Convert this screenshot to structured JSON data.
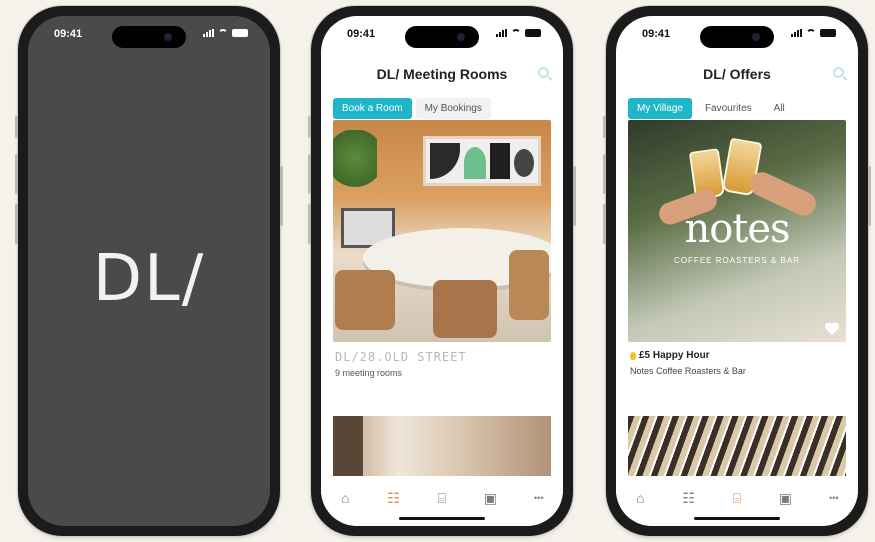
{
  "phones": [
    {
      "status_time": "09:41",
      "logo": "DL/"
    },
    {
      "status_time": "09:41",
      "title": "DL/ Meeting Rooms",
      "tabs": [
        "Book a Room",
        "My Bookings"
      ],
      "room_name": "DL/28.OLD STREET",
      "room_sub": "9 meeting rooms",
      "nav_icons": [
        "home-icon",
        "room-icon",
        "gift-icon",
        "calendar-icon",
        "more-icon"
      ]
    },
    {
      "status_time": "09:41",
      "title": "DL/ Offers",
      "tabs": [
        "My Village",
        "Favourites",
        "All"
      ],
      "offer_brand": "notes",
      "offer_brand_sub": "COFFEE ROASTERS & BAR",
      "offer_title": "£5 Happy Hour",
      "offer_sub": "Notes Coffee Roasters & Bar",
      "nav_icons": [
        "home-icon",
        "room-icon",
        "gift-icon",
        "calendar-icon",
        "more-icon"
      ]
    }
  ],
  "glyphs": {
    "home": "⌂",
    "room": "☷",
    "gift": "⌸",
    "calendar": "▣",
    "more": "•••"
  },
  "colors": {
    "accent": "#1fb6c8",
    "nav_active": "#e0844a",
    "splash_bg": "#4a4a4a"
  }
}
